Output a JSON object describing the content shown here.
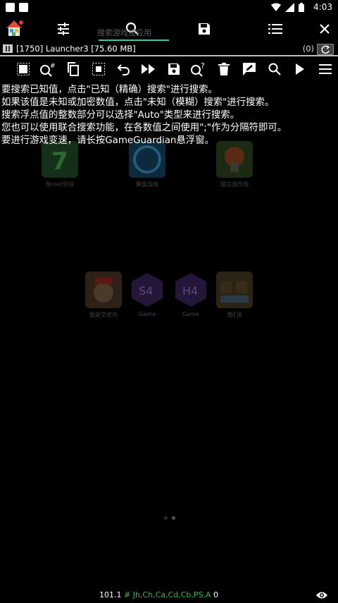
{
  "status_bar": {
    "time": "4:03"
  },
  "top_bar": {
    "search_hint": "搜索游戏或应用"
  },
  "process_bar": {
    "process_info": "[1750] Launcher3 [75.60 MB]",
    "results_count": "(0)"
  },
  "help_text": [
    "要搜索已知值，点击\"已知（精确）搜索\"进行搜索。",
    "如果该值是未知或加密数值，点击\"未知（模糊）搜索\"进行搜索。",
    "搜索浮点值的整数部分可以选择\"Auto\"类型来进行搜索。",
    "您也可以使用联合搜索功能，在各数值之间使用\";\"作为分隔符即可。",
    "要进行游戏变速，请长按GameGuardian悬浮窗。"
  ],
  "apps_row1": [
    {
      "label": "免root空间",
      "color": "#6fbf73"
    },
    {
      "label": "果盘游戏",
      "color": "#3aa0d8"
    },
    {
      "label": "甜瓜游乐场",
      "color": "#7cb342"
    }
  ],
  "apps_row2": [
    {
      "label": "我是文状元",
      "color": "#c8864a"
    },
    {
      "label": "Game",
      "color": "#6a3fa0"
    },
    {
      "label": "Game",
      "color": "#6a3fa0"
    },
    {
      "label": "我们6",
      "color": "#b08040"
    }
  ],
  "footer": {
    "version": "101.1",
    "hash": "# Jh,Ch,Ca,Cd,Cb,PS,A",
    "value": "0"
  }
}
